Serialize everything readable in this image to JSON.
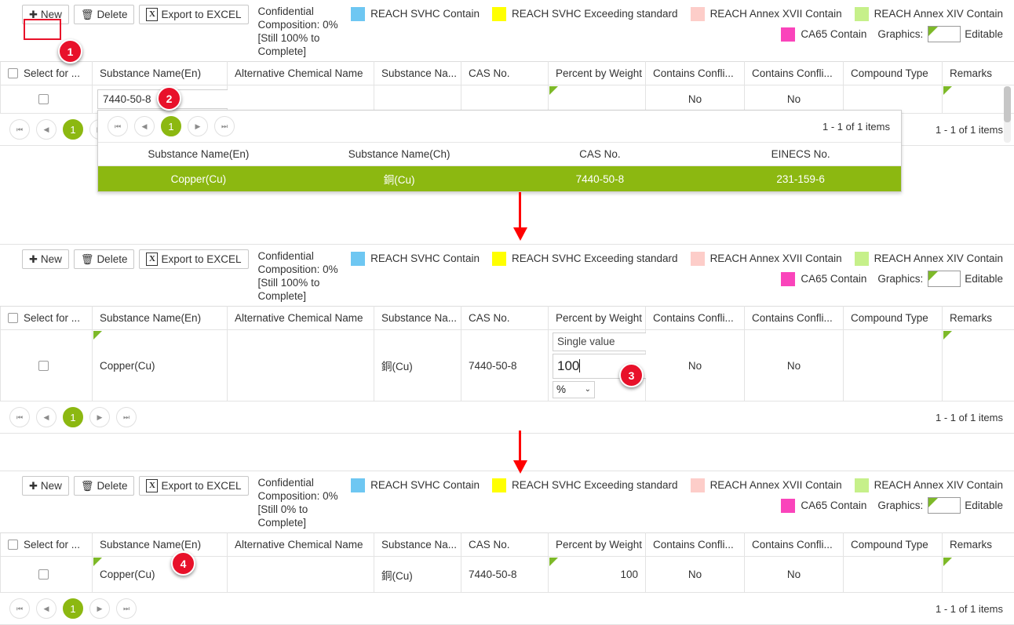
{
  "toolbar": {
    "new_label": "New",
    "delete_label": "Delete",
    "export_label": "Export to EXCEL",
    "new_icon": "plus-icon",
    "delete_icon": "trash-icon",
    "export_icon": "excel-file-icon",
    "confidential_1": "Confidential Composition: 0% [Still 100% to Complete]",
    "confidential_2": "Confidential Composition: 0% [Still 100% to Complete]",
    "confidential_3": "Confidential Composition: 0% [Still 0% to Complete]"
  },
  "legend": {
    "row1": [
      {
        "label": "REACH SVHC Contain",
        "color": "#6ec7f2"
      },
      {
        "label": "REACH SVHC Exceeding standard",
        "color": "#ffff00"
      },
      {
        "label": "REACH Annex XVII Contain",
        "color": "#fdcdc9"
      },
      {
        "label": "REACH Annex XIV Contain",
        "color": "#c6f08a"
      }
    ],
    "row2": [
      {
        "label": "CA65 Contain",
        "color": "#fa44bb"
      }
    ],
    "graphics_label": "Graphics:",
    "graphics_value": "Editable",
    "editable_marker_color": "#7db928"
  },
  "grid": {
    "columns": [
      "Select for ...",
      "Substance Name(En)",
      "Alternative Chemical Name",
      "Substance Na...",
      "CAS No.",
      "Percent by Weight",
      "Contains Confli...",
      "Contains Confli...",
      "Compound Type",
      "Remarks"
    ],
    "row_panel1": {
      "substance_en": "",
      "alt_name": "",
      "substance_ch": "",
      "cas_no": "",
      "percent": "",
      "conflict1": "No",
      "conflict2": "No",
      "compound_type": "",
      "remarks": ""
    },
    "row_panel2": {
      "substance_en": "Copper(Cu)",
      "alt_name": "",
      "substance_ch": "銅(Cu)",
      "cas_no": "7440-50-8",
      "conflict1": "No",
      "conflict2": "No",
      "compound_type": "",
      "remarks": ""
    },
    "row_panel3": {
      "substance_en": "Copper(Cu)",
      "alt_name": "",
      "substance_ch": "銅(Cu)",
      "cas_no": "7440-50-8",
      "percent": "100",
      "conflict1": "No",
      "conflict2": "No",
      "compound_type": "",
      "remarks": ""
    }
  },
  "search_combo": {
    "value": "7440-50-8",
    "clear_icon": "close-icon",
    "toggle_icon": "chevron-down-icon"
  },
  "dropdown": {
    "pager": {
      "first_icon": "first-page-icon",
      "prev_icon": "prev-page-icon",
      "page": "1",
      "next_icon": "next-page-icon",
      "last_icon": "last-page-icon",
      "items_text": "1 - 1 of 1 items"
    },
    "columns": [
      "Substance Name(En)",
      "Substance Name(Ch)",
      "CAS No.",
      "EINECS No."
    ],
    "rows": [
      {
        "name_en": "Copper(Cu)",
        "name_ch": "銅(Cu)",
        "cas_no": "7440-50-8",
        "einecs_no": "231-159-6"
      }
    ],
    "highlight_color": "#8cb811"
  },
  "percent_editor": {
    "mode_label": "Single value",
    "value": "100",
    "unit": "%",
    "unit_chevron": "chevron-down-icon"
  },
  "pagers": {
    "first_icon": "first-page-icon",
    "prev_icon": "prev-page-icon",
    "page": "1",
    "next_icon": "next-page-icon",
    "last_icon": "last-page-icon",
    "items_panel1": "1 - 1 of 1 items",
    "items_panel2": "1 - 1 of 1 items",
    "items_panel3": "1 - 1 of 1 items"
  },
  "annotations": {
    "step1": "1",
    "step2": "2",
    "step3": "3",
    "step4": "4",
    "highlight_color": "#e8112a",
    "arrow_color": "#ff0000"
  }
}
